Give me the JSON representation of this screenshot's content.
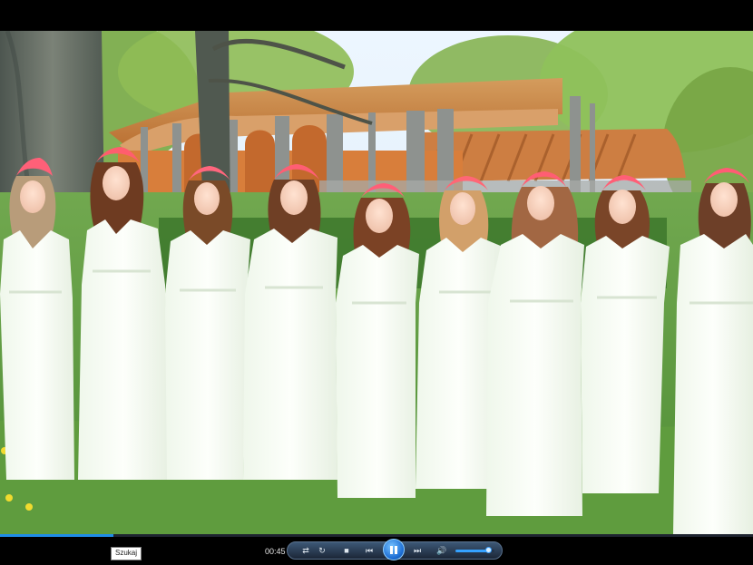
{
  "player": {
    "tooltip": "Szukaj",
    "time_elapsed": "00:45",
    "playback_state": "playing",
    "seek_progress": 0.15,
    "volume_level": 0.85,
    "accent_color": "#1f8de8",
    "controls": {
      "shuffle_icon": "shuffle-icon",
      "repeat_icon": "repeat-icon",
      "stop_icon": "stop-icon",
      "previous_icon": "previous-icon",
      "pause_icon": "pause-icon",
      "next_icon": "next-icon",
      "volume_icon": "speaker-icon"
    }
  }
}
